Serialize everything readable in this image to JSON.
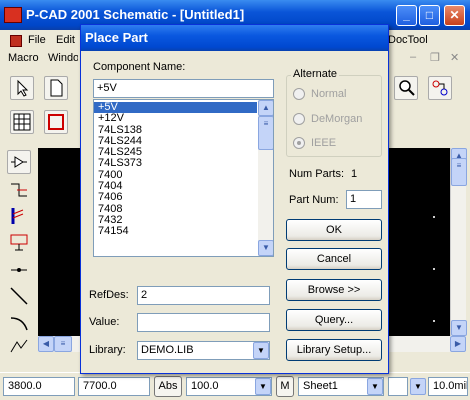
{
  "window": {
    "title": "P-CAD 2001 Schematic - [Untitled1]"
  },
  "menus": [
    "File",
    "Edit",
    "Macro",
    "Window",
    "DocTool"
  ],
  "statusbar": {
    "x": "3800.0",
    "y": "7700.0",
    "abs_label": "Abs",
    "zoom": "100.0",
    "m_label": "M",
    "sheet": "Sheet1",
    "grid": "10.0mil"
  },
  "dialog": {
    "title": "Place Part",
    "component_name_label": "Component Name:",
    "component_name_value": "+5V",
    "parts": [
      "+5V",
      "+12V",
      "74LS138",
      "74LS244",
      "74LS245",
      "74LS373",
      "7400",
      "7404",
      "7406",
      "7408",
      "7432",
      "74154"
    ],
    "selected_part": "+5V",
    "alternate": {
      "label": "Alternate",
      "options": [
        "Normal",
        "DeMorgan",
        "IEEE"
      ],
      "selected": "IEEE"
    },
    "num_parts_label": "Num Parts:",
    "num_parts_value": "1",
    "part_num_label": "Part Num:",
    "part_num_value": "1",
    "refdes_label": "RefDes:",
    "refdes_value": "2",
    "value_label": "Value:",
    "value_value": "",
    "library_label": "Library:",
    "library_value": "DEMO.LIB",
    "buttons": {
      "ok": "OK",
      "cancel": "Cancel",
      "browse": "Browse >>",
      "query": "Query...",
      "library_setup": "Library Setup..."
    }
  }
}
